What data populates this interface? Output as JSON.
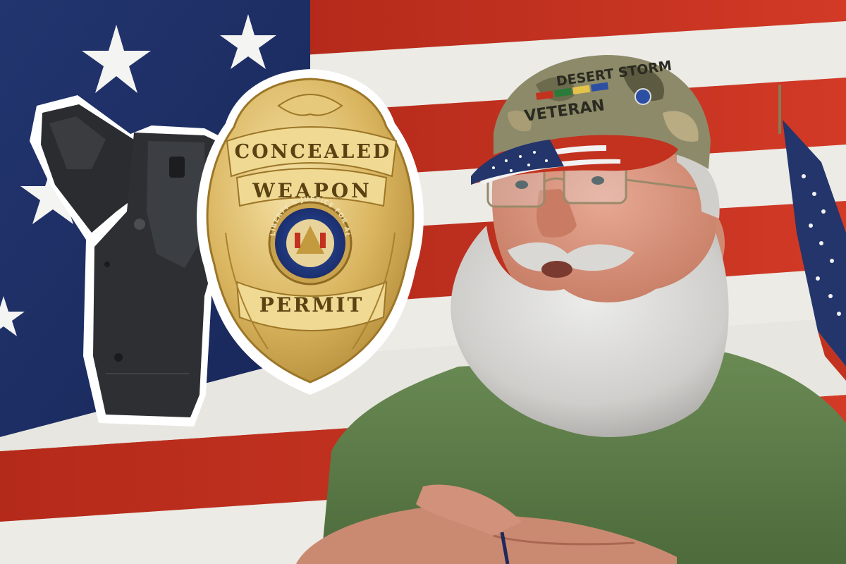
{
  "image": {
    "badge": {
      "line1": "CONCEALED",
      "line2": "WEAPON",
      "line3": "PERMIT",
      "seal_text": "LIBERTY & JUSTICE FOR ALL"
    },
    "cap": {
      "line1": "DESERT STORM",
      "line2": "VETERAN"
    }
  },
  "colors": {
    "flag_blue": "#1e2f63",
    "flag_red": "#c2321f",
    "flag_white": "#ecebe6",
    "badge_gold": "#d9b45e",
    "shirt_green": "#5f7d4a",
    "beard_gray": "#d7d6d2",
    "holster_black": "#2b2d31"
  }
}
